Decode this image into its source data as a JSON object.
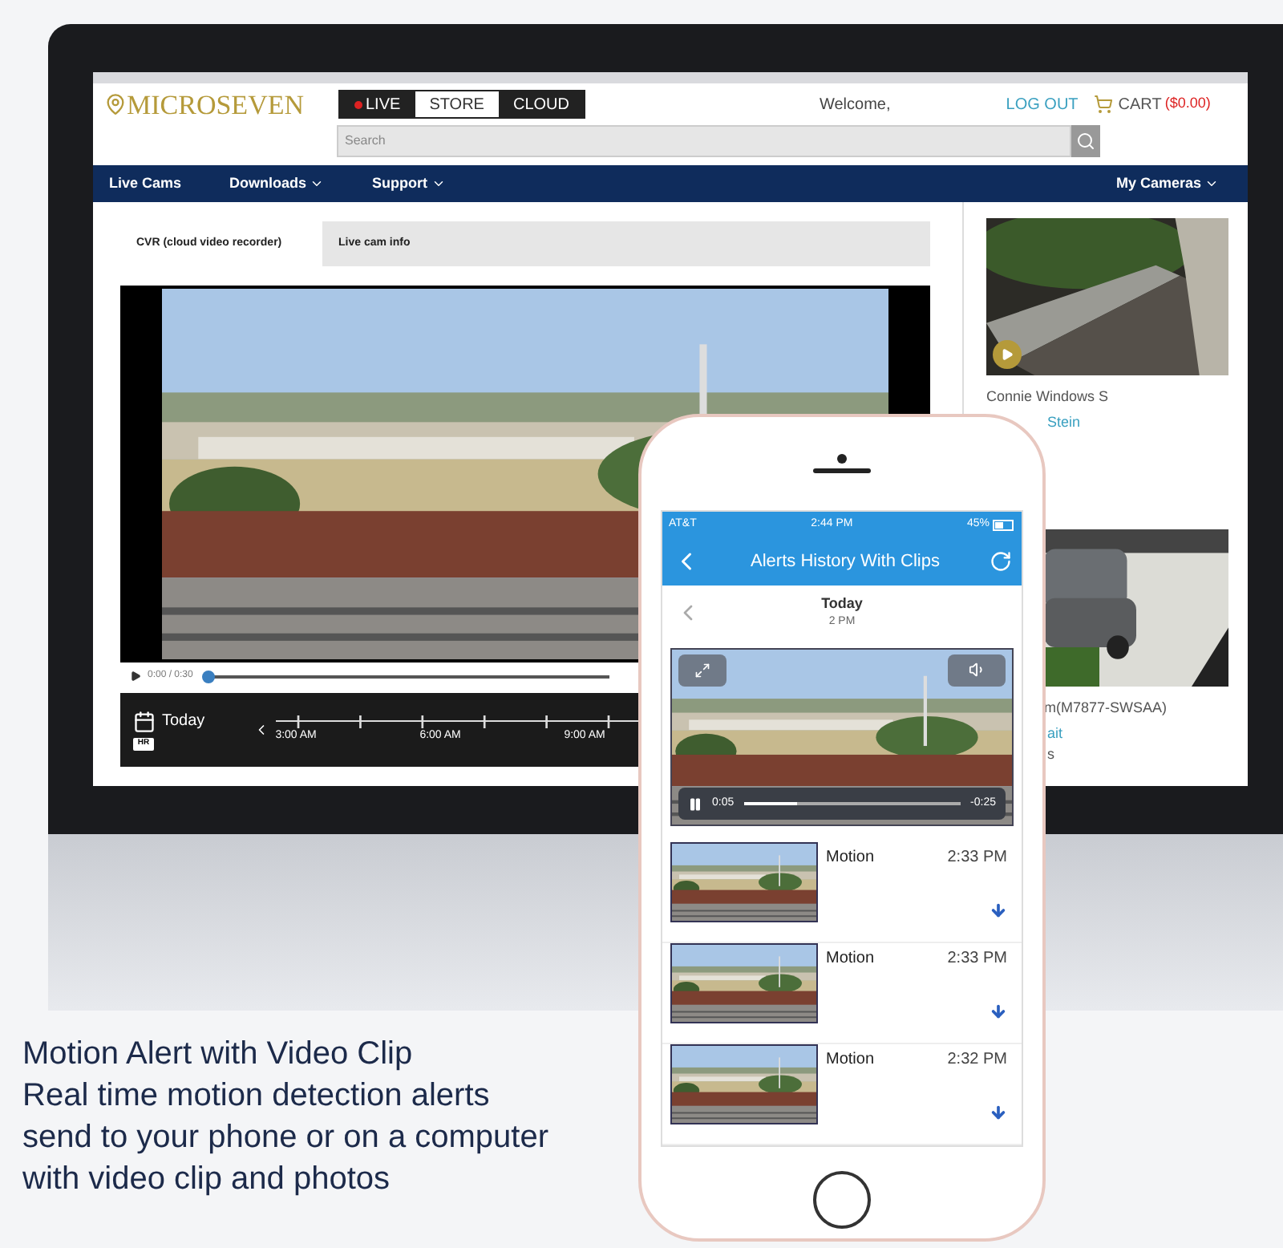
{
  "monitor": {
    "header": {
      "logo": "MICROSEVEN",
      "tabs": [
        {
          "label": "LIVE",
          "selected": false,
          "recording": true
        },
        {
          "label": "STORE",
          "selected": true,
          "recording": false
        },
        {
          "label": "CLOUD",
          "selected": false,
          "recording": false
        }
      ],
      "welcome": "Welcome,",
      "logout": "LOG OUT",
      "cart": "CART",
      "cart_amount": "($0.00)",
      "search": {
        "placeholder": "Search"
      }
    },
    "nav": [
      {
        "label": "Live Cams",
        "dropdown": false
      },
      {
        "label": "Downloads",
        "dropdown": true
      },
      {
        "label": "Support",
        "dropdown": true
      },
      {
        "label": "My Cameras",
        "dropdown": true
      }
    ],
    "content_tabs": [
      {
        "label": "CVR (cloud video recorder)",
        "selected": true
      },
      {
        "label": "Live cam info",
        "selected": false
      }
    ],
    "player": {
      "time": "0:00 / 0:30",
      "level": 0.0
    },
    "timeline": {
      "date": "Today",
      "badge": "HR",
      "ticks": [
        "3:00 AM",
        "6:00 AM",
        "9:00 AM"
      ]
    },
    "cameras": [
      {
        "name": "Connie Windows S",
        "link": "Stein",
        "play": true
      },
      {
        "name": "m(M7877-SWSAA)",
        "link": "ait",
        "play": false,
        "extra": "s"
      }
    ]
  },
  "phone": {
    "status": {
      "carrier": "AT&T",
      "time": "2:44 PM",
      "battery": "45%"
    },
    "title": "Alerts History With Clips",
    "date": "Today",
    "hour": "2 PM",
    "clip": {
      "elapsed": "0:05",
      "remaining": "-0:25",
      "level": 0.25
    },
    "alerts": [
      {
        "type": "Motion",
        "time": "2:33 PM"
      },
      {
        "type": "Motion",
        "time": "2:33 PM"
      },
      {
        "type": "Motion",
        "time": "2:32 PM"
      }
    ]
  },
  "caption": {
    "title": "Motion Alert with Video Clip",
    "text": "Real time motion detection alerts send to your phone or on a computer with video clip and photos"
  }
}
